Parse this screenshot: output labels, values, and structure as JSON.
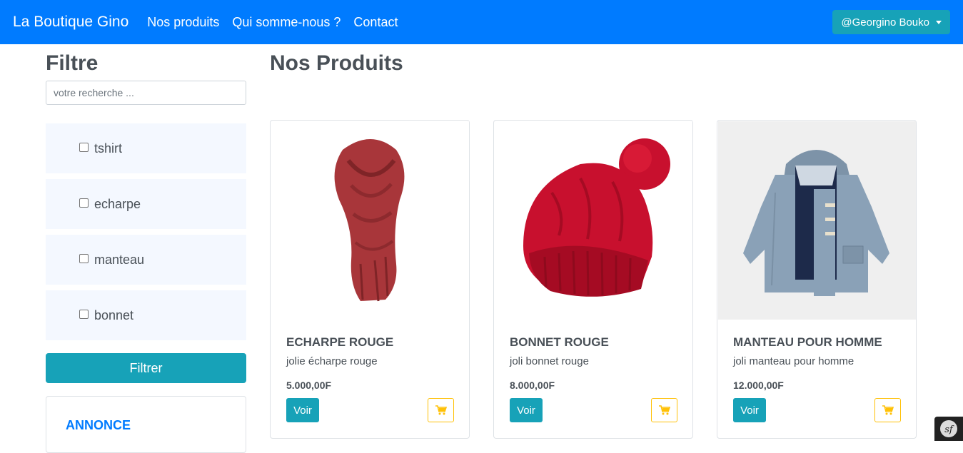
{
  "navbar": {
    "brand": "La Boutique Gino",
    "links": [
      "Nos produits",
      "Qui somme-nous ?",
      "Contact"
    ],
    "user": "@Georgino Bouko",
    "colors": {
      "bg": "#007bff",
      "user_btn": "#17a2b8"
    }
  },
  "sidebar": {
    "title": "Filtre",
    "search_placeholder": "votre recherche ...",
    "categories": [
      "tshirt",
      "echarpe",
      "manteau",
      "bonnet"
    ],
    "filter_button": "Filtrer",
    "annonce_title": "ANNONCE"
  },
  "main": {
    "title": "Nos Produits",
    "products": [
      {
        "name": "ECHARPE ROUGE",
        "description": "jolie écharpe rouge",
        "price": "5.000,00F",
        "button": "Voir",
        "image": "red-scarf"
      },
      {
        "name": "BONNET ROUGE",
        "description": "joli bonnet rouge",
        "price": "8.000,00F",
        "button": "Voir",
        "image": "red-beanie"
      },
      {
        "name": "MANTEAU POUR HOMME",
        "description": "joli manteau pour homme",
        "price": "12.000,00F",
        "button": "Voir",
        "image": "blue-coat"
      }
    ]
  },
  "icons": {
    "cart": "cart-icon",
    "symfony": "symfony-icon"
  },
  "debug_badge": "sf"
}
